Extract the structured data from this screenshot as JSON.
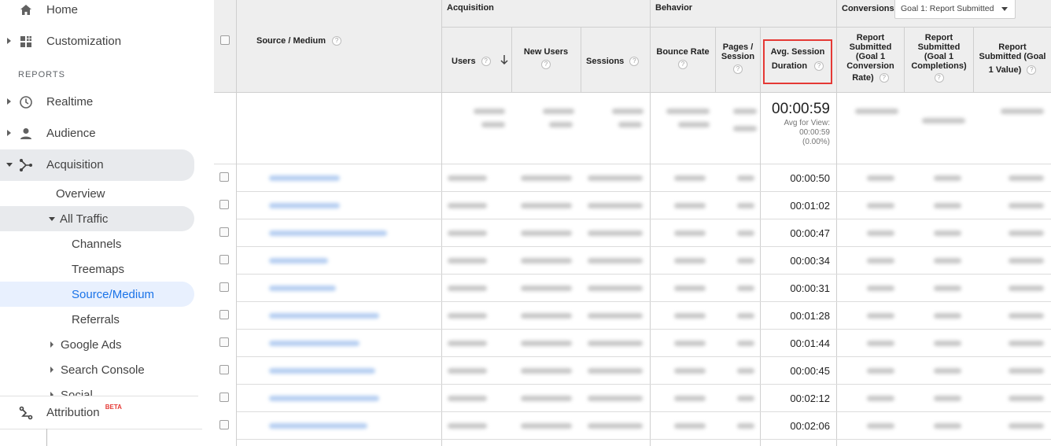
{
  "sidebar": {
    "home": "Home",
    "customization": "Customization",
    "reports_header": "REPORTS",
    "realtime": "Realtime",
    "audience": "Audience",
    "acquisition": "Acquisition",
    "overview": "Overview",
    "all_traffic": "All Traffic",
    "channels": "Channels",
    "treemaps": "Treemaps",
    "source_medium": "Source/Medium",
    "referrals": "Referrals",
    "google_ads": "Google Ads",
    "search_console": "Search Console",
    "social": "Social",
    "attribution": "Attribution",
    "beta_badge": "BETA"
  },
  "table": {
    "groups": {
      "acquisition": "Acquisition",
      "behavior": "Behavior",
      "conversions": "Conversions"
    },
    "goal_select": "Goal 1: Report Submitted",
    "columns": {
      "source_medium": "Source / Medium",
      "users": "Users",
      "new_users": "New Users",
      "sessions": "Sessions",
      "bounce_rate": "Bounce Rate",
      "pages_session_1": "Pages /",
      "pages_session_2": "Session",
      "avg_session_1": "Avg. Session",
      "avg_session_2": "Duration",
      "conv_rate": [
        "Report",
        "Submitted",
        "(Goal 1",
        "Conversion",
        "Rate)"
      ],
      "completions": [
        "Report",
        "Submitted",
        "(Goal 1",
        "Completions)"
      ],
      "value": [
        "Report",
        "Submitted (Goal",
        "1 Value)"
      ]
    },
    "help_glyph": "?",
    "totals": {
      "avg_duration": "00:00:59",
      "avg_for_view_label": "Avg for View:",
      "avg_for_view_value": "00:00:59",
      "avg_for_view_pct": "(0.00%)"
    },
    "rows": [
      {
        "duration": "00:00:50"
      },
      {
        "duration": "00:01:02"
      },
      {
        "duration": "00:00:47"
      },
      {
        "duration": "00:00:34"
      },
      {
        "duration": "00:00:31"
      },
      {
        "duration": "00:01:28"
      },
      {
        "duration": "00:01:44"
      },
      {
        "duration": "00:00:45"
      },
      {
        "duration": "00:02:12"
      },
      {
        "duration": "00:02:06"
      }
    ]
  },
  "colors": {
    "highlight_border": "#e53935",
    "active_nav": "#1a73e8",
    "header_bg": "#eeeeee"
  }
}
